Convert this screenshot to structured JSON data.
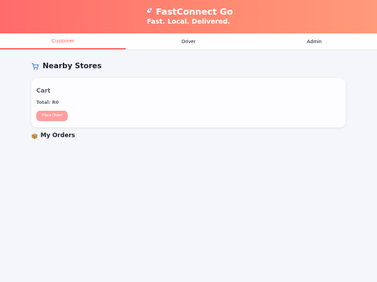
{
  "header": {
    "title": "FastConnect Go",
    "subtitle": "Fast. Local. Delivered.",
    "icon": "rocket-icon"
  },
  "tabs": [
    {
      "label": "Customer",
      "active": true
    },
    {
      "label": "Driver",
      "active": false
    },
    {
      "label": "Admin",
      "active": false
    }
  ],
  "stores": {
    "title": "Nearby Stores",
    "icon": "cart-icon"
  },
  "cart": {
    "title": "Cart",
    "total": "Total: R0",
    "button_label": "Place Order"
  },
  "orders": {
    "title": "My Orders",
    "icon": "package-icon"
  },
  "colors": {
    "accent": "#ff6b6b",
    "header_gradient_end": "#ff9a7a",
    "button_disabled": "#ff9e9e",
    "background": "#f5f6f9"
  }
}
